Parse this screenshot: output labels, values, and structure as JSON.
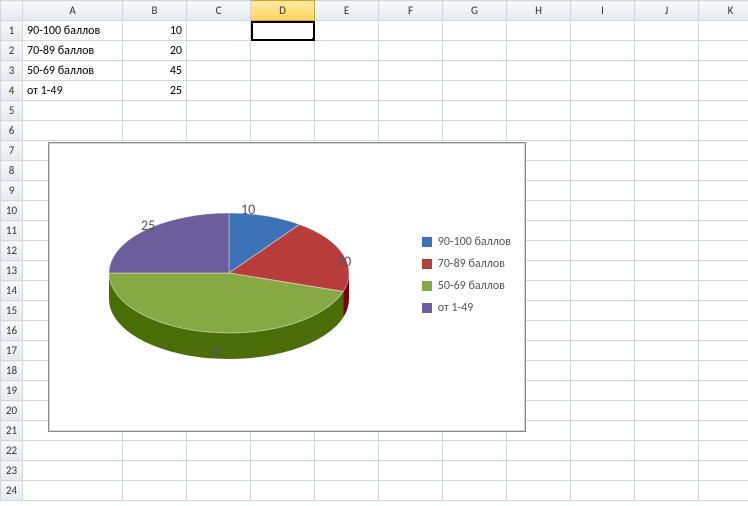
{
  "grid": {
    "columns": [
      "A",
      "B",
      "C",
      "D",
      "E",
      "F",
      "G",
      "H",
      "I",
      "J",
      "K"
    ],
    "selected_column": "D",
    "selected_cell": "D1",
    "rows_visible": 24,
    "data": [
      {
        "A": "90-100 баллов",
        "B": 10
      },
      {
        "A": "70-89 баллов",
        "B": 20
      },
      {
        "A": "50-69 баллов",
        "B": 45
      },
      {
        "A": "от 1-49",
        "B": 25
      }
    ]
  },
  "chart_data": {
    "type": "pie",
    "title": "",
    "categories": [
      "90-100 баллов",
      "70-89 баллов",
      "50-69 баллов",
      "от 1-49"
    ],
    "values": [
      10,
      20,
      45,
      25
    ],
    "colors": [
      "#3b72b8",
      "#b83c3a",
      "#87a943",
      "#6c5e9c"
    ],
    "data_labels": [
      10,
      20,
      45,
      25
    ],
    "legend_position": "right",
    "style": "3d"
  }
}
